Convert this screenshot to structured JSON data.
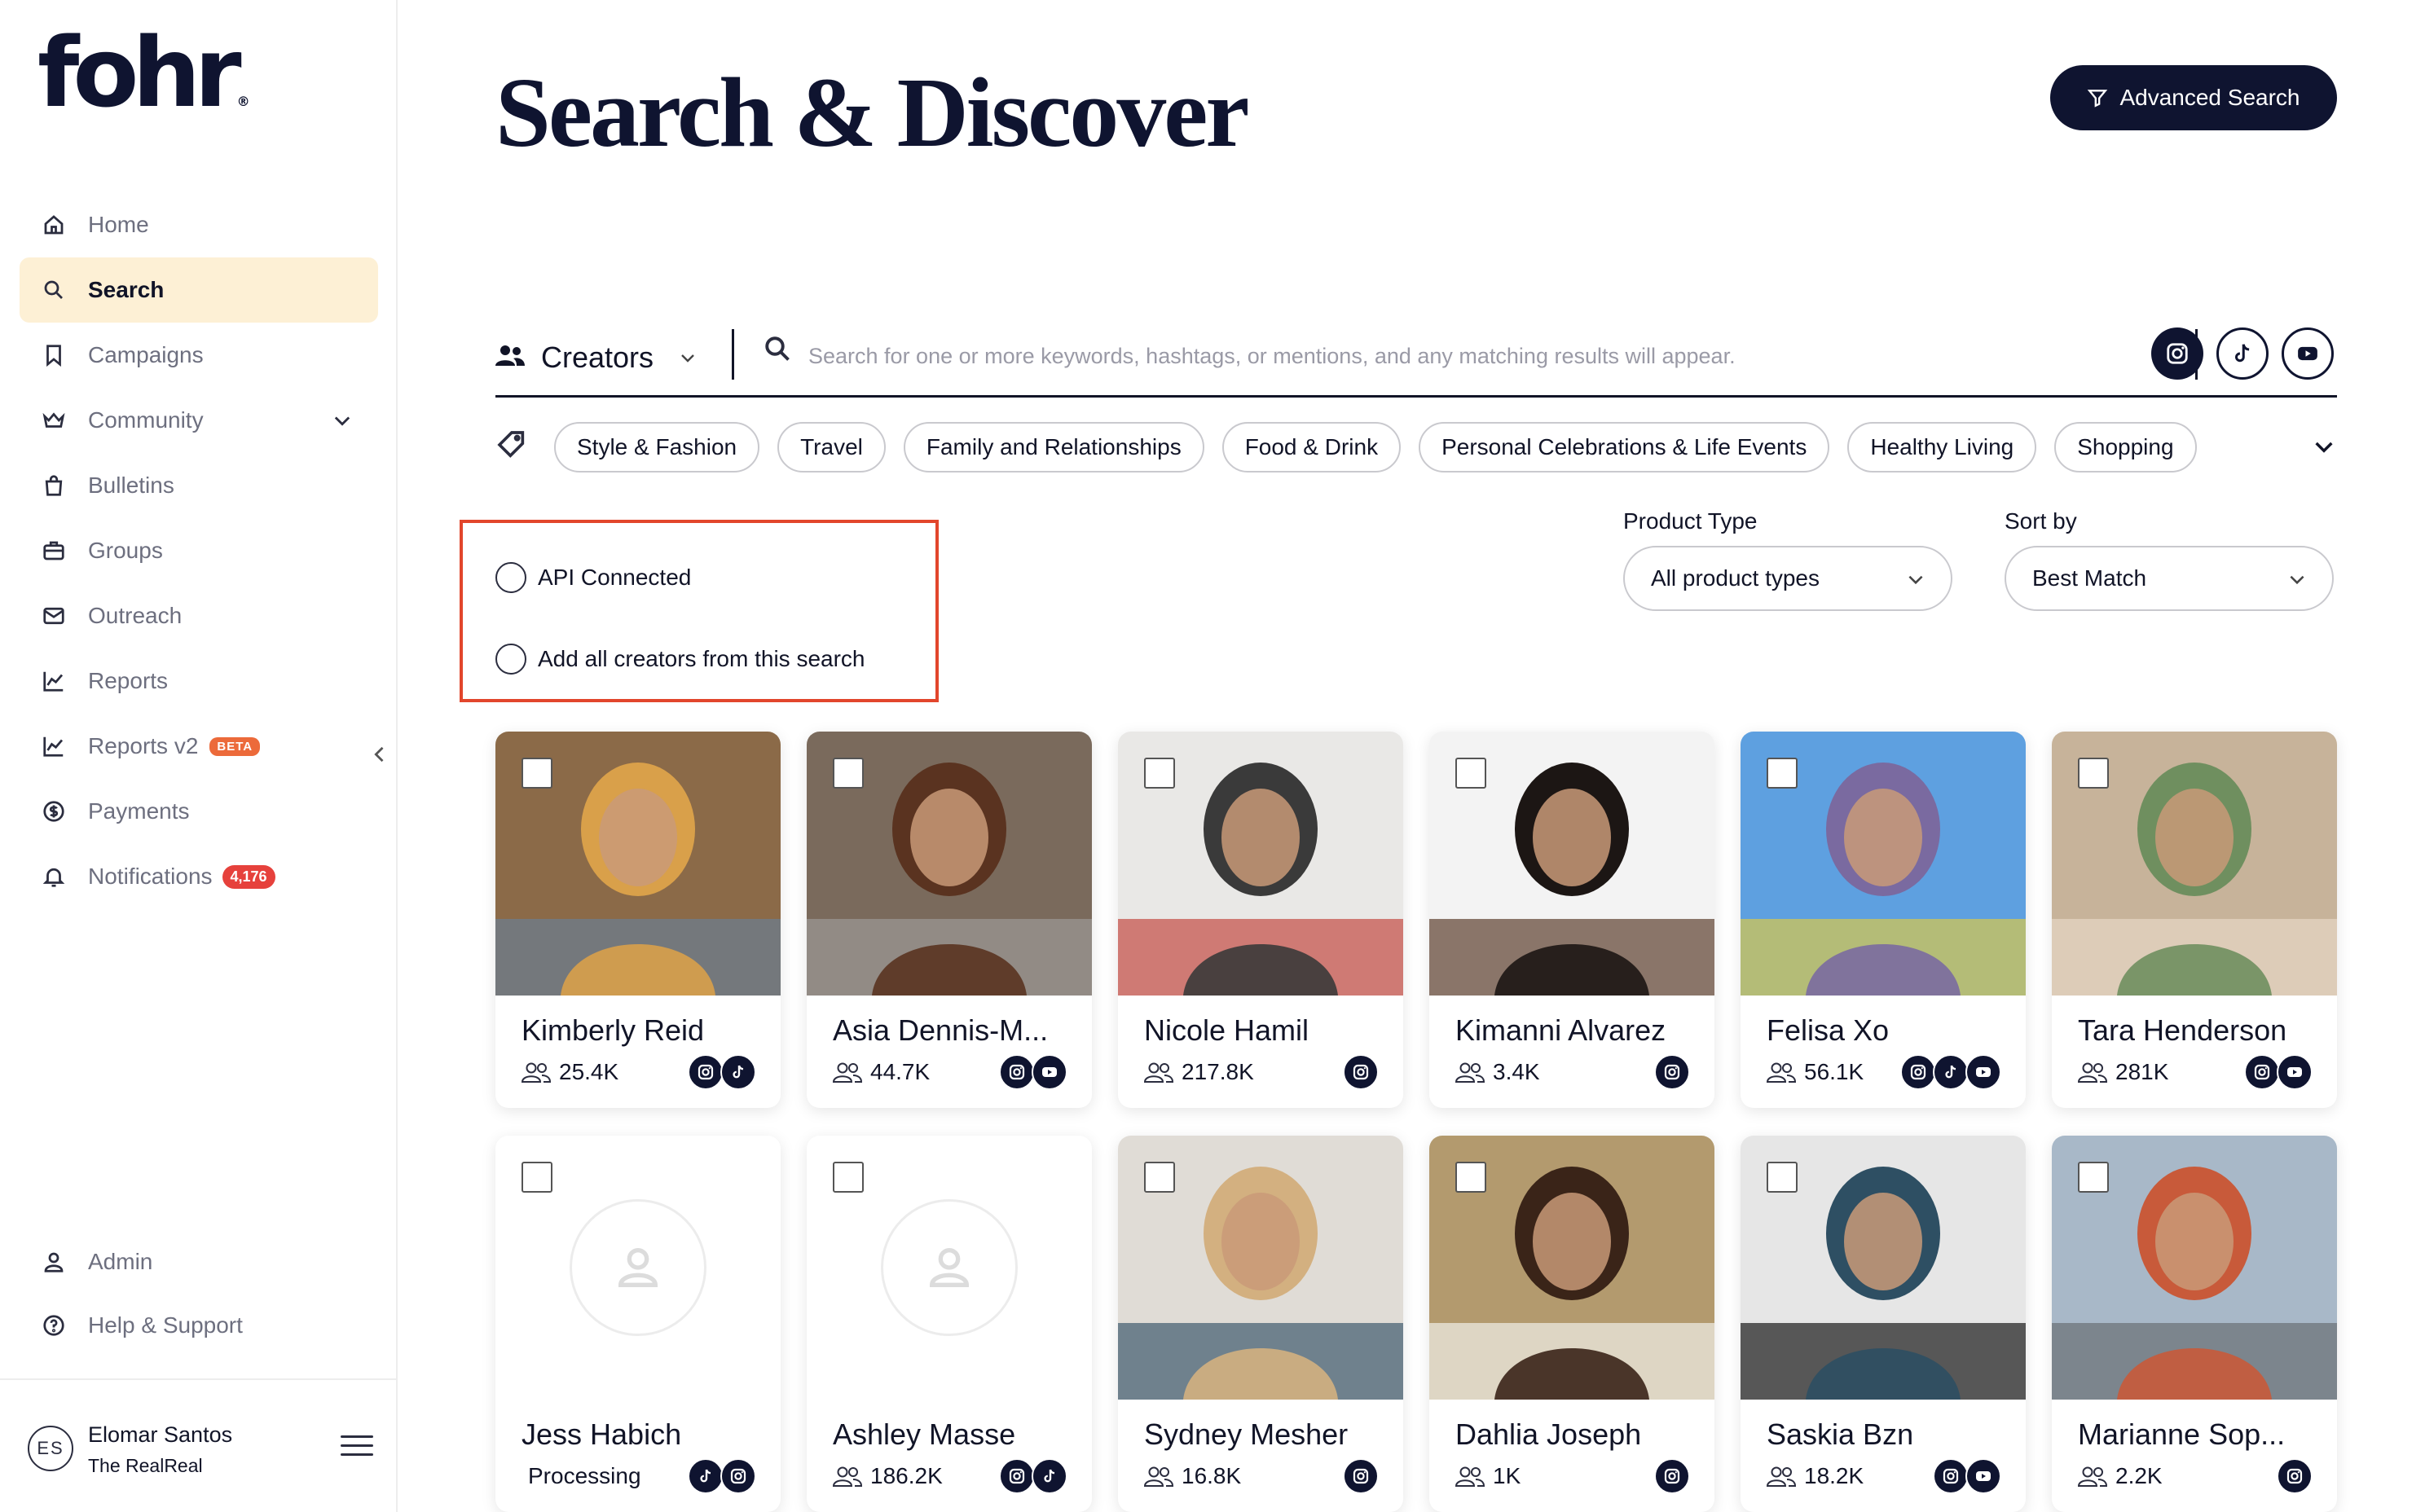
{
  "brand": {
    "logo_text": "fohr",
    "reg_mark": "®"
  },
  "sidebar": {
    "items": [
      {
        "label": "Home",
        "icon": "home-icon"
      },
      {
        "label": "Search",
        "icon": "search-icon",
        "active": true
      },
      {
        "label": "Campaigns",
        "icon": "bookmark-icon"
      },
      {
        "label": "Community",
        "icon": "crown-icon",
        "has_dropdown": true
      },
      {
        "label": "Bulletins",
        "icon": "bag-icon"
      },
      {
        "label": "Groups",
        "icon": "briefcase-icon"
      },
      {
        "label": "Outreach",
        "icon": "mail-icon"
      },
      {
        "label": "Reports",
        "icon": "chart-icon"
      },
      {
        "label": "Reports v2",
        "icon": "chart-icon",
        "badge": "BETA"
      },
      {
        "label": "Payments",
        "icon": "dollar-icon"
      },
      {
        "label": "Notifications",
        "icon": "bell-icon",
        "badge": "4,176"
      }
    ],
    "bottom_items": [
      {
        "label": "Admin",
        "icon": "user-icon"
      },
      {
        "label": "Help & Support",
        "icon": "help-icon"
      }
    ],
    "user": {
      "initials": "ES",
      "name": "Elomar Santos",
      "org": "The RealReal"
    }
  },
  "header": {
    "title": "Search & Discover",
    "advanced_search_label": "Advanced Search"
  },
  "search": {
    "entity_label": "Creators",
    "placeholder": "Search for one or more keywords, hashtags, or mentions, and any matching results will appear.",
    "platforms": [
      "instagram",
      "tiktok",
      "youtube"
    ]
  },
  "tags": [
    "Style & Fashion",
    "Travel",
    "Family and Relationships",
    "Food & Drink",
    "Personal Celebrations & Life Events",
    "Healthy Living",
    "Shopping"
  ],
  "options": {
    "api_connected_label": "API Connected",
    "add_all_label": "Add all creators from this search"
  },
  "filters": {
    "product_type_label": "Product Type",
    "product_type_value": "All product types",
    "sort_by_label": "Sort by",
    "sort_by_value": "Best Match"
  },
  "creators": [
    {
      "name": "Kimberly Reid",
      "followers": "25.4K",
      "socials": [
        "instagram",
        "tiktok"
      ],
      "photo": true,
      "colors": [
        "#8b6a48",
        "#d9a04a",
        "#6b7f93"
      ]
    },
    {
      "name": "Asia Dennis-M...",
      "followers": "44.7K",
      "socials": [
        "instagram",
        "youtube"
      ],
      "photo": true,
      "colors": [
        "#7a6a5c",
        "#5a3320",
        "#9c9a97"
      ]
    },
    {
      "name": "Nicole Hamil",
      "followers": "217.8K",
      "socials": [
        "instagram"
      ],
      "photo": true,
      "colors": [
        "#e9e8e6",
        "#3a3a3a",
        "#c34b43"
      ]
    },
    {
      "name": "Kimanni Alvarez",
      "followers": "3.4K",
      "socials": [
        "instagram"
      ],
      "photo": true,
      "colors": [
        "#f3f3f3",
        "#1c1614",
        "#5c3e2d"
      ]
    },
    {
      "name": "Felisa Xo",
      "followers": "56.1K",
      "socials": [
        "instagram",
        "tiktok",
        "youtube"
      ],
      "photo": true,
      "colors": [
        "#5ea0e0",
        "#7a6aa0",
        "#d8c84a"
      ]
    },
    {
      "name": "Tara Henderson",
      "followers": "281K",
      "socials": [
        "instagram",
        "youtube"
      ],
      "photo": true,
      "colors": [
        "#c7b39a",
        "#6f8f5f",
        "#e7d7c4"
      ]
    },
    {
      "name": "Jess Habich",
      "status": "Processing",
      "socials": [
        "tiktok",
        "instagram"
      ],
      "photo": false
    },
    {
      "name": "Ashley Masse",
      "followers": "186.2K",
      "socials": [
        "instagram",
        "tiktok"
      ],
      "photo": false
    },
    {
      "name": "Sydney Mesher",
      "followers": "16.8K",
      "socials": [
        "instagram"
      ],
      "photo": true,
      "colors": [
        "#e0dcd6",
        "#d3b080",
        "#3f5a6e"
      ]
    },
    {
      "name": "Dahlia Joseph",
      "followers": "1K",
      "socials": [
        "instagram"
      ],
      "photo": true,
      "colors": [
        "#b39a6e",
        "#3a2418",
        "#f1efe8"
      ]
    },
    {
      "name": "Saskia Bzn",
      "followers": "18.2K",
      "socials": [
        "instagram",
        "youtube"
      ],
      "photo": true,
      "colors": [
        "#e6e6e6",
        "#2e4f63",
        "#1a1a1a"
      ]
    },
    {
      "name": "Marianne Sop...",
      "followers": "2.2K",
      "socials": [
        "instagram"
      ],
      "photo": true,
      "colors": [
        "#a8b8c8",
        "#c85a3a",
        "#6a6f74"
      ]
    }
  ]
}
